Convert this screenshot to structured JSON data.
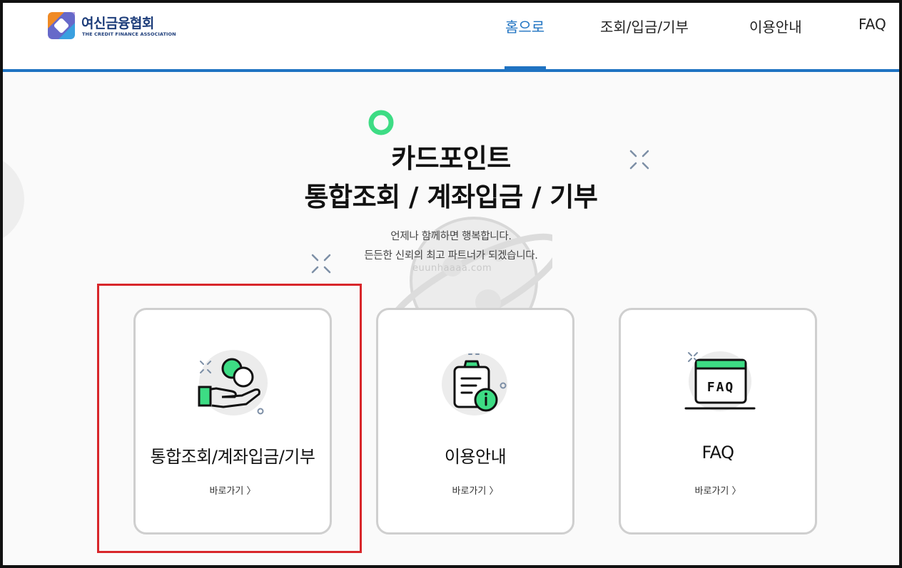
{
  "header": {
    "logo_title": "여신금융협회",
    "logo_subtitle": "THE CREDIT FINANCE ASSOCIATION",
    "nav": [
      {
        "label": "홈으로",
        "active": true
      },
      {
        "label": "조회/입금/기부",
        "active": false
      },
      {
        "label": "이용안내",
        "active": false
      },
      {
        "label": "FAQ",
        "active": false
      }
    ]
  },
  "hero": {
    "title_line1": "카드포인트",
    "title_line2": "통합조회 / 계좌입금 / 기부",
    "subtitle_line1": "언제나 함께하면 행복합니다.",
    "subtitle_line2": "든든한 신뢰의 최고 파트너가 되겠습니다.",
    "watermark": "euunhaaaa.com"
  },
  "cards": [
    {
      "title": "통합조회/계좌입금/기부",
      "link": "바로가기 〉",
      "icon": "hand-coin-icon"
    },
    {
      "title": "이용안내",
      "link": "바로가기 〉",
      "icon": "clipboard-info-icon"
    },
    {
      "title": "FAQ",
      "link": "바로가기 〉",
      "icon": "faq-monitor-icon",
      "icon_text": "FAQ"
    }
  ],
  "colors": {
    "accent_blue": "#1f73c2",
    "accent_green": "#3ddc84",
    "highlight_red": "#d8262a",
    "card_border": "#cfcfcf"
  }
}
